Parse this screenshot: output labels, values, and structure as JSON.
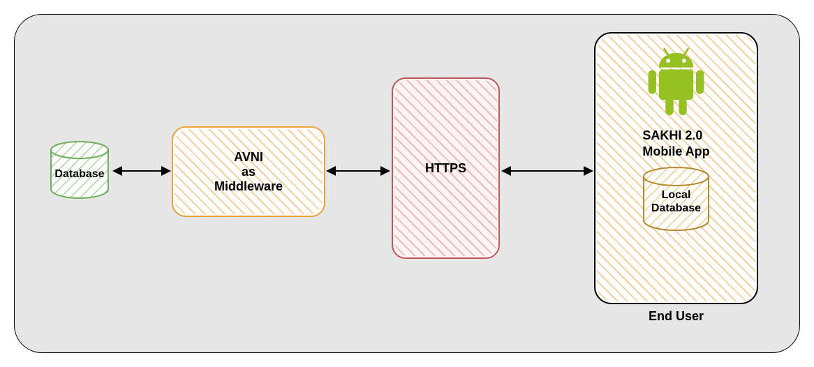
{
  "nodes": {
    "database": {
      "label": "Database"
    },
    "middleware": {
      "line1": "AVNI",
      "line2": "as",
      "line3": "Middleware"
    },
    "https": {
      "label": "HTTPS"
    },
    "endUser": {
      "appTitle1": "SAKHI 2.0",
      "appTitle2": "Mobile App",
      "localDb1": "Local",
      "localDb2": "Database",
      "caption": "End User"
    }
  },
  "icons": {
    "android": "android-icon",
    "databaseCylinder": "database-cylinder-icon"
  },
  "colors": {
    "canvasBg": "#e6e6e6",
    "dbStroke": "#6fae5b",
    "middlewareStroke": "#e8a23a",
    "httpsStroke": "#bd5656",
    "localDbStroke": "#b58a2e",
    "androidGreen": "#97c024"
  }
}
